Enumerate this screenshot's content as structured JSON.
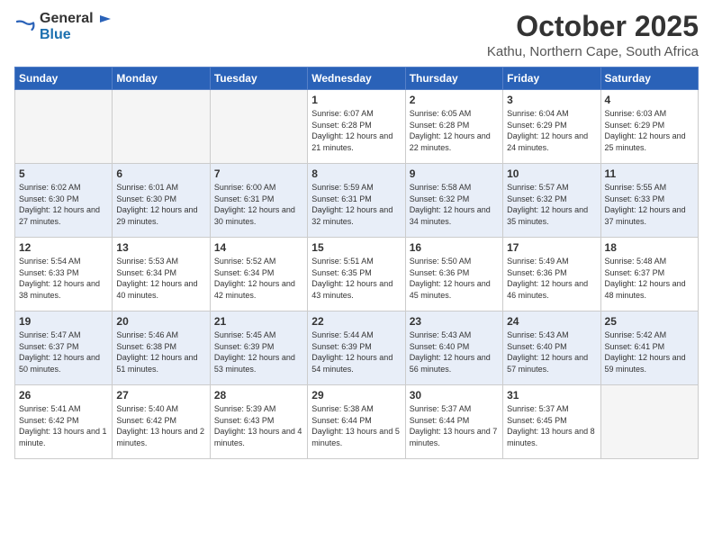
{
  "logo": {
    "general": "General",
    "blue": "Blue"
  },
  "header": {
    "month": "October 2025",
    "location": "Kathu, Northern Cape, South Africa"
  },
  "weekdays": [
    "Sunday",
    "Monday",
    "Tuesday",
    "Wednesday",
    "Thursday",
    "Friday",
    "Saturday"
  ],
  "weeks": [
    [
      {
        "day": "",
        "empty": true
      },
      {
        "day": "",
        "empty": true
      },
      {
        "day": "",
        "empty": true
      },
      {
        "day": "1",
        "sunrise": "Sunrise: 6:07 AM",
        "sunset": "Sunset: 6:28 PM",
        "daylight": "Daylight: 12 hours and 21 minutes."
      },
      {
        "day": "2",
        "sunrise": "Sunrise: 6:05 AM",
        "sunset": "Sunset: 6:28 PM",
        "daylight": "Daylight: 12 hours and 22 minutes."
      },
      {
        "day": "3",
        "sunrise": "Sunrise: 6:04 AM",
        "sunset": "Sunset: 6:29 PM",
        "daylight": "Daylight: 12 hours and 24 minutes."
      },
      {
        "day": "4",
        "sunrise": "Sunrise: 6:03 AM",
        "sunset": "Sunset: 6:29 PM",
        "daylight": "Daylight: 12 hours and 25 minutes."
      }
    ],
    [
      {
        "day": "5",
        "sunrise": "Sunrise: 6:02 AM",
        "sunset": "Sunset: 6:30 PM",
        "daylight": "Daylight: 12 hours and 27 minutes."
      },
      {
        "day": "6",
        "sunrise": "Sunrise: 6:01 AM",
        "sunset": "Sunset: 6:30 PM",
        "daylight": "Daylight: 12 hours and 29 minutes."
      },
      {
        "day": "7",
        "sunrise": "Sunrise: 6:00 AM",
        "sunset": "Sunset: 6:31 PM",
        "daylight": "Daylight: 12 hours and 30 minutes."
      },
      {
        "day": "8",
        "sunrise": "Sunrise: 5:59 AM",
        "sunset": "Sunset: 6:31 PM",
        "daylight": "Daylight: 12 hours and 32 minutes."
      },
      {
        "day": "9",
        "sunrise": "Sunrise: 5:58 AM",
        "sunset": "Sunset: 6:32 PM",
        "daylight": "Daylight: 12 hours and 34 minutes."
      },
      {
        "day": "10",
        "sunrise": "Sunrise: 5:57 AM",
        "sunset": "Sunset: 6:32 PM",
        "daylight": "Daylight: 12 hours and 35 minutes."
      },
      {
        "day": "11",
        "sunrise": "Sunrise: 5:55 AM",
        "sunset": "Sunset: 6:33 PM",
        "daylight": "Daylight: 12 hours and 37 minutes."
      }
    ],
    [
      {
        "day": "12",
        "sunrise": "Sunrise: 5:54 AM",
        "sunset": "Sunset: 6:33 PM",
        "daylight": "Daylight: 12 hours and 38 minutes."
      },
      {
        "day": "13",
        "sunrise": "Sunrise: 5:53 AM",
        "sunset": "Sunset: 6:34 PM",
        "daylight": "Daylight: 12 hours and 40 minutes."
      },
      {
        "day": "14",
        "sunrise": "Sunrise: 5:52 AM",
        "sunset": "Sunset: 6:34 PM",
        "daylight": "Daylight: 12 hours and 42 minutes."
      },
      {
        "day": "15",
        "sunrise": "Sunrise: 5:51 AM",
        "sunset": "Sunset: 6:35 PM",
        "daylight": "Daylight: 12 hours and 43 minutes."
      },
      {
        "day": "16",
        "sunrise": "Sunrise: 5:50 AM",
        "sunset": "Sunset: 6:36 PM",
        "daylight": "Daylight: 12 hours and 45 minutes."
      },
      {
        "day": "17",
        "sunrise": "Sunrise: 5:49 AM",
        "sunset": "Sunset: 6:36 PM",
        "daylight": "Daylight: 12 hours and 46 minutes."
      },
      {
        "day": "18",
        "sunrise": "Sunrise: 5:48 AM",
        "sunset": "Sunset: 6:37 PM",
        "daylight": "Daylight: 12 hours and 48 minutes."
      }
    ],
    [
      {
        "day": "19",
        "sunrise": "Sunrise: 5:47 AM",
        "sunset": "Sunset: 6:37 PM",
        "daylight": "Daylight: 12 hours and 50 minutes."
      },
      {
        "day": "20",
        "sunrise": "Sunrise: 5:46 AM",
        "sunset": "Sunset: 6:38 PM",
        "daylight": "Daylight: 12 hours and 51 minutes."
      },
      {
        "day": "21",
        "sunrise": "Sunrise: 5:45 AM",
        "sunset": "Sunset: 6:39 PM",
        "daylight": "Daylight: 12 hours and 53 minutes."
      },
      {
        "day": "22",
        "sunrise": "Sunrise: 5:44 AM",
        "sunset": "Sunset: 6:39 PM",
        "daylight": "Daylight: 12 hours and 54 minutes."
      },
      {
        "day": "23",
        "sunrise": "Sunrise: 5:43 AM",
        "sunset": "Sunset: 6:40 PM",
        "daylight": "Daylight: 12 hours and 56 minutes."
      },
      {
        "day": "24",
        "sunrise": "Sunrise: 5:43 AM",
        "sunset": "Sunset: 6:40 PM",
        "daylight": "Daylight: 12 hours and 57 minutes."
      },
      {
        "day": "25",
        "sunrise": "Sunrise: 5:42 AM",
        "sunset": "Sunset: 6:41 PM",
        "daylight": "Daylight: 12 hours and 59 minutes."
      }
    ],
    [
      {
        "day": "26",
        "sunrise": "Sunrise: 5:41 AM",
        "sunset": "Sunset: 6:42 PM",
        "daylight": "Daylight: 13 hours and 1 minute."
      },
      {
        "day": "27",
        "sunrise": "Sunrise: 5:40 AM",
        "sunset": "Sunset: 6:42 PM",
        "daylight": "Daylight: 13 hours and 2 minutes."
      },
      {
        "day": "28",
        "sunrise": "Sunrise: 5:39 AM",
        "sunset": "Sunset: 6:43 PM",
        "daylight": "Daylight: 13 hours and 4 minutes."
      },
      {
        "day": "29",
        "sunrise": "Sunrise: 5:38 AM",
        "sunset": "Sunset: 6:44 PM",
        "daylight": "Daylight: 13 hours and 5 minutes."
      },
      {
        "day": "30",
        "sunrise": "Sunrise: 5:37 AM",
        "sunset": "Sunset: 6:44 PM",
        "daylight": "Daylight: 13 hours and 7 minutes."
      },
      {
        "day": "31",
        "sunrise": "Sunrise: 5:37 AM",
        "sunset": "Sunset: 6:45 PM",
        "daylight": "Daylight: 13 hours and 8 minutes."
      },
      {
        "day": "",
        "empty": true
      }
    ]
  ]
}
